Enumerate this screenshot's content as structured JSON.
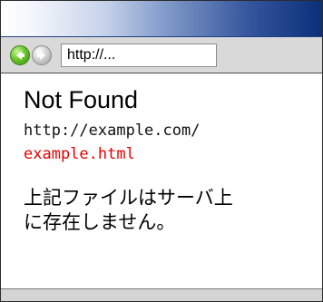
{
  "toolbar": {
    "back_icon": "back-arrow-icon",
    "forward_icon": "forward-arrow-icon",
    "address_value": "http://..."
  },
  "page": {
    "title": "Not Found",
    "url_line1": "http://example.com/",
    "url_line2": "example.html",
    "message_line1": "上記ファイルはサーバ上",
    "message_line2": "に存在しません。"
  },
  "colors": {
    "titlebar_accent": "#0b2f7a",
    "url_highlight": "#e60000",
    "back_button": "#6cc52a"
  }
}
